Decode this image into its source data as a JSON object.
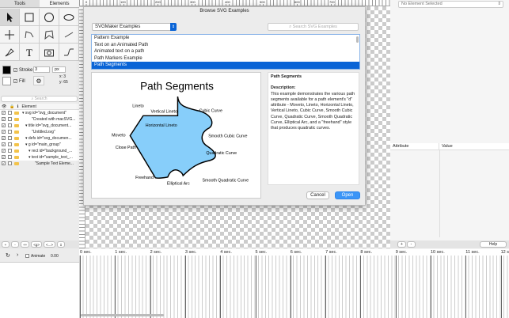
{
  "left_panel": {
    "tabs": [
      "Tools",
      "Elements"
    ],
    "stroke_label": "Stroke",
    "stroke_value": "3",
    "stroke_unit": "px",
    "fill_label": "Fill",
    "x_readout": "x: 3",
    "y_readout": "y: 65",
    "search_placeholder": "Search",
    "element_header": "Element",
    "elements": [
      "▾ svg id=\"svg_document\"",
      "\"Created with macSVG...",
      "▾ title id=\"svg_document...",
      "\"Untitled.svg\"",
      "▾ defs id=\"svg_documen...",
      "▾ g id=\"main_group\"",
      "▾ rect id=\"background_...",
      "▾ text id=\"sample_text_...",
      "\"Sample Text Eleme..."
    ],
    "bottom_buttons": [
      "+",
      "-",
      "++",
      "<g>",
      "<...>",
      "⇓"
    ]
  },
  "ruler_labels": [
    "0",
    "100",
    "200",
    "300",
    "400",
    "500",
    "600",
    "700"
  ],
  "dialog": {
    "title": "Browse SVG Examples",
    "source_select": "SVGMaker Examples",
    "search_placeholder": "Search SVG Examples",
    "examples": [
      "Pattern Example",
      "Text on an Animated Path",
      "Animated text on a path",
      "Path Markers Example",
      "Path Segments"
    ],
    "selected_index": 4,
    "preview": {
      "title": "Path Segments",
      "labels": [
        "Lineto",
        "Vertical Lineto",
        "Cubic Curve",
        "Horizontal Lineto",
        "Moveto",
        "Smooth Cubic Curve",
        "Close Path",
        "Quadratic Curve",
        "Freehand",
        "Elliptical Arc",
        "Smooth Quadratic Curve"
      ]
    },
    "desc_title": "Path Segments",
    "desc_heading": "Description:",
    "desc_body": "This example demonstrates the various path segments available for a path element's \"d\" attribute - Moveto, Lineto, Horizontal Lineto, Vertical Lineto, Cubic Curve, Smooth Cubic Curve, Quadratic Curve, Smooth Quadratic Curve, Elliptical Arc, and a \"freehand\" style that produces quadratic curves.",
    "cancel": "Cancel",
    "open": "Open",
    "accent": "#0a64d6",
    "shape_fill": "#87cefa"
  },
  "right_panel": {
    "element_select": "No Element Selected",
    "columns": [
      "Attribute",
      "Value"
    ],
    "bottom_buttons": [
      "+",
      "-"
    ],
    "help": "Help"
  },
  "timeline": {
    "animate_label": "Animate",
    "time": "0.00",
    "seconds": [
      "0 sec.",
      "1 sec.",
      "2 sec.",
      "3 sec.",
      "4 sec.",
      "5 sec.",
      "6 sec.",
      "7 sec.",
      "8 sec.",
      "9 sec.",
      "10 sec.",
      "11 sec.",
      "12 s"
    ]
  }
}
